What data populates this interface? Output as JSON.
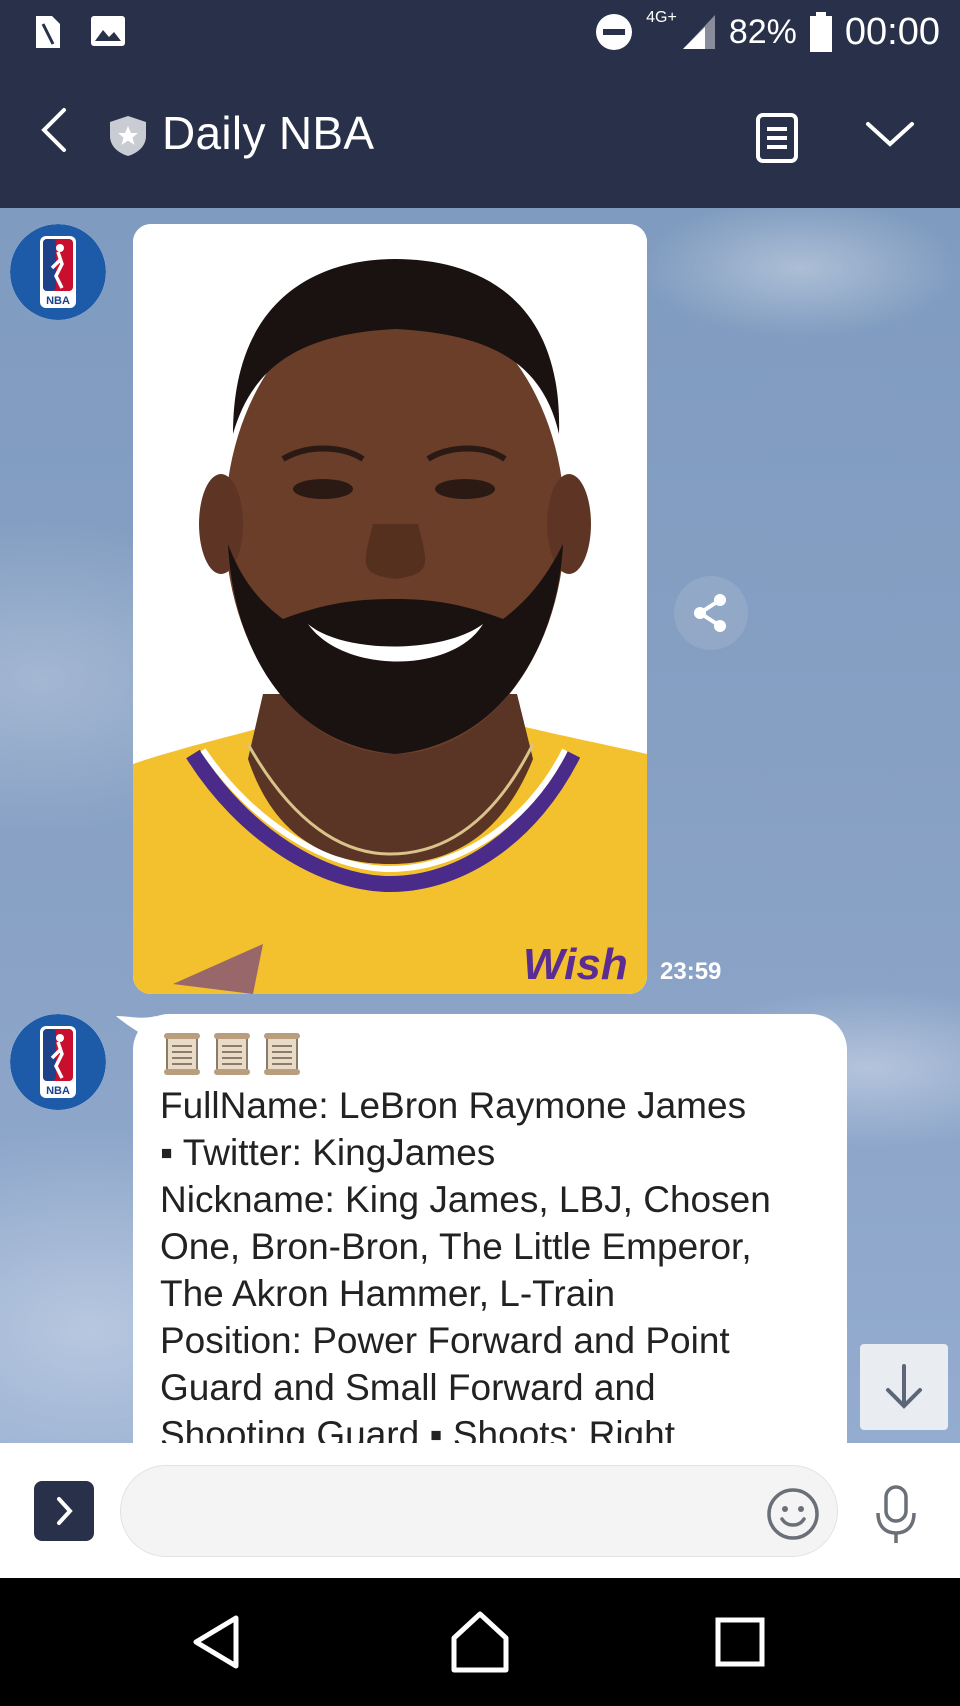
{
  "status_bar": {
    "network": "4G+",
    "battery": "82%",
    "time": "00:00"
  },
  "header": {
    "title": "Daily NBA"
  },
  "messages": [
    {
      "type": "image",
      "alt": "LeBron James portrait in yellow Lakers jersey",
      "jersey_text": "Wish",
      "time": "23:59"
    },
    {
      "type": "text",
      "icons": [
        "scroll-icon",
        "scroll-icon",
        "scroll-icon"
      ],
      "lines": [
        "FullName: LeBron Raymone James",
        " ▪ Twitter: KingJames",
        "Nickname: King James, LBJ, Chosen",
        "One, Bron-Bron, The Little Emperor,",
        "The Akron Hammer, L-Train",
        "Position: Power Forward and Point",
        "Guard and Small Forward and",
        "Shooting Guard  ▪  Shoots: Right"
      ]
    }
  ],
  "input": {
    "placeholder": ""
  },
  "avatar": {
    "logo_text": "NBA"
  },
  "colors": {
    "header_bg": "#283149",
    "chat_bg": "#8aa3c6"
  }
}
